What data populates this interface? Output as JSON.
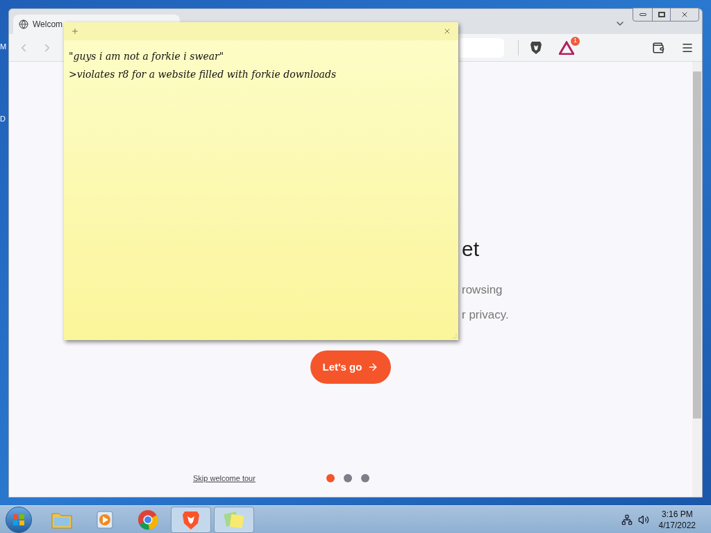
{
  "desktop": {
    "icon_labels": [
      "M",
      "D"
    ]
  },
  "browser": {
    "tabs": [
      {
        "title": "Welcom",
        "selected": true
      }
    ],
    "toolbar": {
      "notification_badge": "1"
    },
    "page": {
      "heading": "et",
      "lines": [
        "rowsing",
        "r privacy."
      ],
      "primary_button": "Let's go",
      "skip_link": "Skip welcome tour",
      "pager": [
        {
          "selected": true
        },
        {
          "selected": false
        },
        {
          "selected": false
        }
      ]
    }
  },
  "sticky_note": {
    "lines": [
      "\"guys i am not a forkie i swear\"",
      ">violates r8 for a website filled with forkie downloads"
    ]
  },
  "taskbar": {
    "items": [
      {
        "kind": "folder",
        "selected": false
      },
      {
        "kind": "media",
        "selected": false
      },
      {
        "kind": "chrome",
        "selected": false
      },
      {
        "kind": "brave",
        "selected": true
      },
      {
        "kind": "notes",
        "selected": true
      }
    ],
    "clock": {
      "time": "3:16 PM",
      "date": "4/17/2022"
    }
  }
}
